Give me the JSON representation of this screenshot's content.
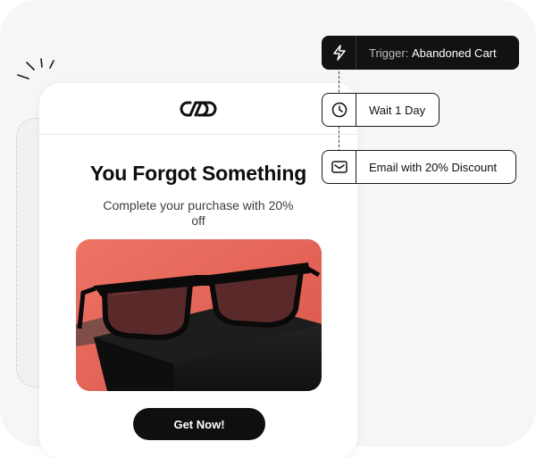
{
  "email": {
    "logo_icon": "infinity-link-logo",
    "headline": "You Forgot Something",
    "subtext": "Complete your purchase with 20% off",
    "image_subject": "black-sunglasses-product-photo",
    "cta_label": "Get Now!"
  },
  "workflow": {
    "trigger_prefix": "Trigger:",
    "trigger_value": "Abandoned Cart",
    "trigger_icon": "lightning-icon",
    "wait_label": "Wait 1 Day",
    "wait_icon": "clock-icon",
    "email_label": "Email with 20% Discount",
    "email_icon": "mail-icon"
  },
  "colors": {
    "background": "#f6f6f6",
    "card": "#ffffff",
    "cta": "#0f0f0f",
    "trigger_bg": "#121212",
    "product_bg": "#e8675c"
  }
}
